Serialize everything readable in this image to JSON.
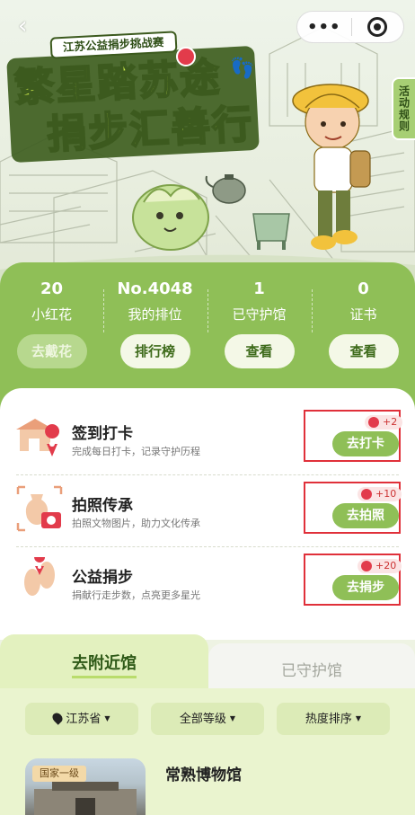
{
  "nav": {
    "back_icon": "back-chevron-icon",
    "more_icon": "more-dots-icon",
    "close_icon": "target-close-icon"
  },
  "hero": {
    "subtitle": "江苏公益捐步挑战赛",
    "title_line1": "繁星踏苏途",
    "title_line2": "捐步汇善行",
    "rules_label": "活动规则"
  },
  "stats": [
    {
      "value": "20",
      "label": "小红花",
      "button": "去戴花"
    },
    {
      "value": "No.4048",
      "label": "我的排位",
      "button": "排行榜"
    },
    {
      "value": "1",
      "label": "已守护馆",
      "button": "查看"
    },
    {
      "value": "0",
      "label": "证书",
      "button": "查看"
    }
  ],
  "tasks": [
    {
      "name": "签到打卡",
      "desc": "完成每日打卡，记录守护历程",
      "bonus": "+2",
      "button": "去打卡",
      "icon": "gate-location-icon"
    },
    {
      "name": "拍照传承",
      "desc": "拍照文物图片，助力文化传承",
      "bonus": "+10",
      "button": "去拍照",
      "icon": "vase-camera-icon"
    },
    {
      "name": "公益捐步",
      "desc": "捐献行走步数，点亮更多星光",
      "bonus": "+20",
      "button": "去捐步",
      "icon": "footprint-icon"
    }
  ],
  "tabs": {
    "active": "去附近馆",
    "inactive": "已守护馆"
  },
  "filters": {
    "province": "江苏省",
    "level": "全部等级",
    "sort": "热度排序"
  },
  "museum": {
    "level": "国家一级",
    "name": "常熟博物馆"
  },
  "colors": {
    "accent_green": "#8fbf57",
    "highlight_red": "#e0303a",
    "bonus_red": "#e23b4b"
  }
}
